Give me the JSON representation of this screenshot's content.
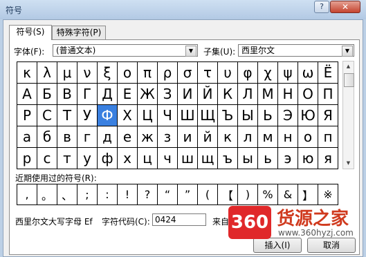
{
  "window": {
    "title": "符号",
    "help": "?",
    "close": "✕"
  },
  "tabs": [
    {
      "label": "符号(S)"
    },
    {
      "label": "特殊字符(P)"
    }
  ],
  "font": {
    "label": "字体(F):",
    "value": "(普通文本)"
  },
  "subset": {
    "label": "子集(U):",
    "value": "西里尔文"
  },
  "symbol_grid": [
    [
      "κ",
      "λ",
      "μ",
      "ν",
      "ξ",
      "ο",
      "π",
      "ρ",
      "σ",
      "τ",
      "υ",
      "φ",
      "χ",
      "ψ",
      "ω",
      "Ё"
    ],
    [
      "А",
      "Б",
      "В",
      "Г",
      "Д",
      "Е",
      "Ж",
      "З",
      "И",
      "Й",
      "К",
      "Л",
      "М",
      "Н",
      "О",
      "П"
    ],
    [
      "Р",
      "С",
      "Т",
      "У",
      "Ф",
      "Х",
      "Ц",
      "Ч",
      "Ш",
      "Щ",
      "Ъ",
      "Ы",
      "Ь",
      "Э",
      "Ю",
      "Я"
    ],
    [
      "а",
      "б",
      "в",
      "г",
      "д",
      "е",
      "ж",
      "з",
      "и",
      "й",
      "к",
      "л",
      "м",
      "н",
      "о",
      "п"
    ],
    [
      "р",
      "с",
      "т",
      "у",
      "ф",
      "х",
      "ц",
      "ч",
      "ш",
      "щ",
      "ъ",
      "ы",
      "ь",
      "э",
      "ю",
      "я"
    ]
  ],
  "selected_symbol": {
    "row": 2,
    "col": 4
  },
  "recent": {
    "label": "近期使用过的符号(R):",
    "symbols": [
      ",",
      "。",
      "、",
      ";",
      ":",
      "!",
      "?",
      "“",
      "”",
      "(",
      "【",
      ")",
      "%",
      "&",
      "】",
      "※"
    ]
  },
  "char_name": "西里尔文大写字母 Ef",
  "char_code": {
    "label": "字符代码(C):",
    "value": "0424"
  },
  "from": {
    "label": "来自(M):"
  },
  "buttons": {
    "insert": "插入(I)",
    "cancel": "取消"
  },
  "watermark": {
    "badge": "360",
    "name": "货源之家",
    "url": "www.360hyzj.com"
  },
  "colors": {
    "selection": "#3a80e0",
    "watermark_red": "#e0282a"
  }
}
